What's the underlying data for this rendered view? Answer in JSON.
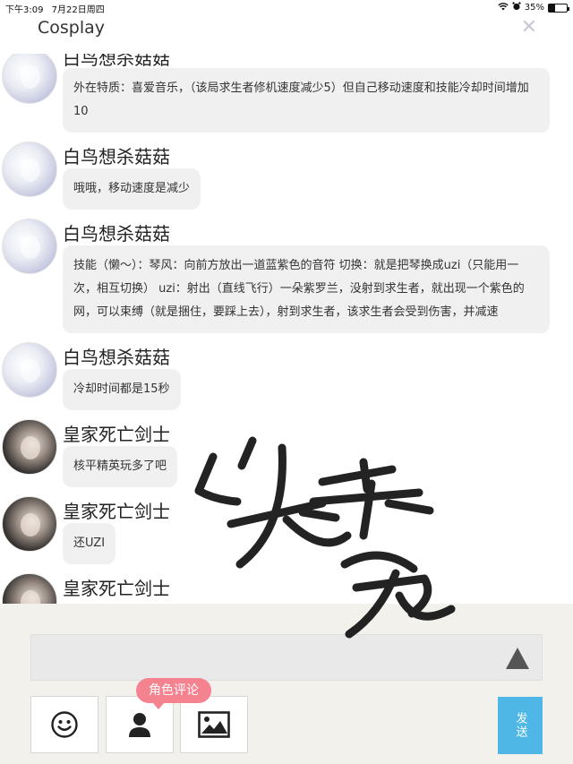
{
  "status_bar": {
    "time": "下午3:09",
    "date": "7月22日周四",
    "battery": "35%",
    "battery_level": 0.35
  },
  "header": {
    "title": "Cosplay",
    "close_symbol": "✕"
  },
  "messages": [
    {
      "name": "白鸟想杀菇菇",
      "text": "外在特质：喜爱音乐，（该局求生者修机速度减少5）但自己移动速度和技能冷却时间增加10"
    },
    {
      "name": "白鸟想杀菇菇",
      "text": "哦哦，移动速度是减少"
    },
    {
      "name": "白鸟想杀菇菇",
      "text": "技能（懒～）：琴风：向前方放出一道蓝紫色的音符 切换：就是把琴换成uzi（只能用一次，相互切换） uzi：射出（直线飞行）一朵紫罗兰，没射到求生者，就出现一个紫色的网，可以束缚（就是捆住，要踩上去），射到求生者，该求生者会受到伤害，并减速"
    },
    {
      "name": "白鸟想杀菇菇",
      "text": "冷却时间都是15秒"
    },
    {
      "name": "皇家死亡剑士",
      "text": "核平精英玩多了吧"
    },
    {
      "name": "皇家死亡剑士",
      "text": "还UZI"
    },
    {
      "name": "皇家死亡剑士",
      "text": ""
    }
  ],
  "input": {
    "placeholder": ""
  },
  "toolbar": {
    "role_comment_badge": "角色评论",
    "send_label": "发送"
  },
  "colors": {
    "badge": "#f4828f",
    "send": "#4fb7e6",
    "bubble": "#f0f0f0",
    "panel": "#f3f1ec"
  }
}
